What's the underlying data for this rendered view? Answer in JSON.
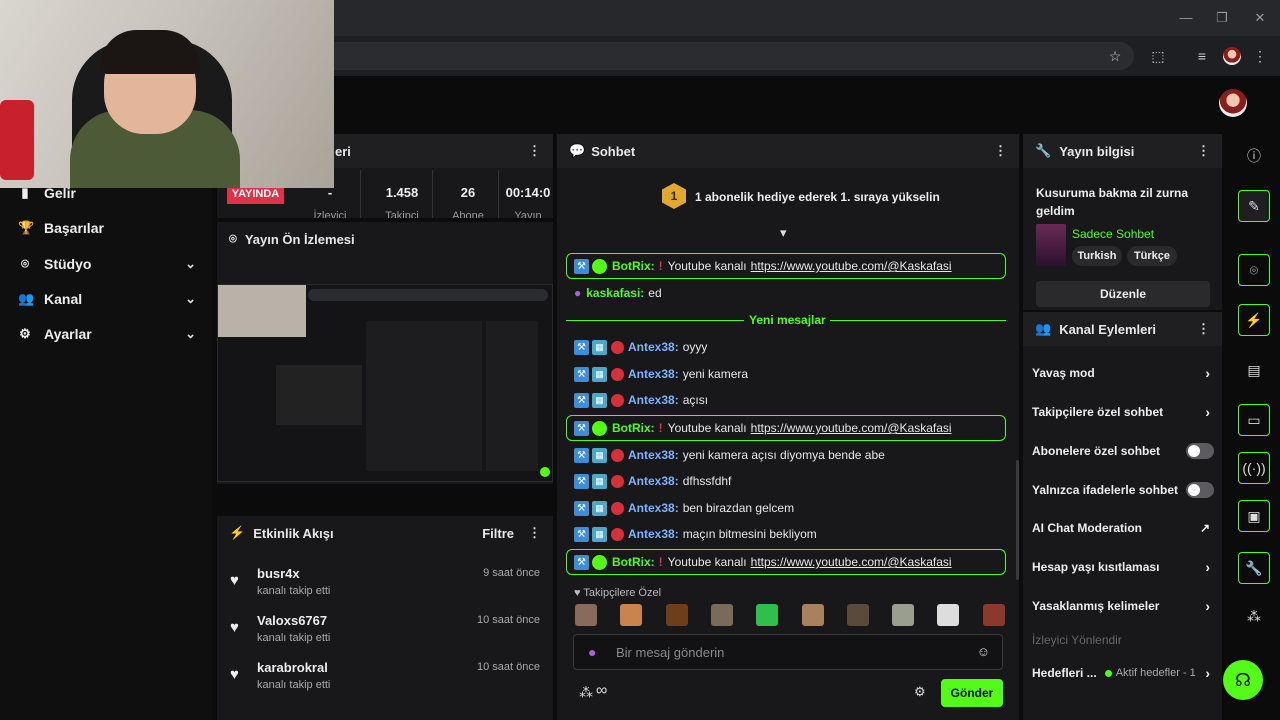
{
  "nav": {
    "items": [
      {
        "label": "Gelir",
        "icon": "chart-icon",
        "chevron": false
      },
      {
        "label": "Başarılar",
        "icon": "trophy-icon",
        "chevron": false
      },
      {
        "label": "Stüdyo",
        "icon": "studio-icon",
        "chevron": true
      },
      {
        "label": "Kanal",
        "icon": "users-icon",
        "chevron": true
      },
      {
        "label": "Ayarlar",
        "icon": "gear-icon",
        "chevron": true
      }
    ]
  },
  "stats": {
    "header_label": "eri",
    "live_badge": "YAYINDA",
    "values": [
      {
        "value": "-",
        "sub": "İzleyici"
      },
      {
        "value": "1.458",
        "sub": "Takipçi"
      },
      {
        "value": "26",
        "sub": "Abone"
      },
      {
        "value": "00:14:0",
        "sub": "Yayın"
      }
    ]
  },
  "preview": {
    "title": "Yayın Ön İzlemesi"
  },
  "feed": {
    "title": "Etkinlik Akışı",
    "filter_label": "Filtre",
    "items": [
      {
        "name": "busr4x",
        "action": "kanalı takip etti",
        "time": "9 saat önce"
      },
      {
        "name": "Valoxs6767",
        "action": "kanalı takip etti",
        "time": "10 saat önce"
      },
      {
        "name": "karabrokral",
        "action": "kanalı takip etti",
        "time": "10 saat önce"
      }
    ]
  },
  "chat": {
    "title": "Sohbet",
    "gift_banner": "1 abonelik hediye ederek 1. sıraya yükselin",
    "gift_rank": "1",
    "new_messages_divider": "Yeni mesajlar",
    "messages": [
      {
        "user": "BotRix",
        "text": "Youtube kanalı",
        "link": "https://www.youtube.com/@Kaskafasi",
        "bot": true
      },
      {
        "user": "kaskafasi",
        "text": "ed",
        "owner": true
      },
      {
        "user": "Antex38",
        "text": "oyyy"
      },
      {
        "user": "Antex38",
        "text": "yeni kamera"
      },
      {
        "user": "Antex38",
        "text": "açısı"
      },
      {
        "user": "BotRix",
        "text": "Youtube kanalı",
        "link": "https://www.youtube.com/@Kaskafasi",
        "bot": true
      },
      {
        "user": "Antex38",
        "text": "yeni kamera açısı diyomya bende abe"
      },
      {
        "user": "Antex38",
        "text": "dfhssfdhf"
      },
      {
        "user": "Antex38",
        "text": "ben birazdan gelcem"
      },
      {
        "user": "Antex38",
        "text": "maçın bitmesini bekliyom"
      },
      {
        "user": "BotRix",
        "text": "Youtube kanalı",
        "link": "https://www.youtube.com/@Kaskafasi",
        "bot": true
      }
    ],
    "followers_label": "Takipçilere Özel",
    "input_placeholder": "Bir mesaj gönderin",
    "send_label": "Gönder",
    "infinity": "∞"
  },
  "stream_info": {
    "title": "Yayın bilgisi",
    "stream_title": "Kusuruma bakma zil zurna geldim",
    "category": "Sadece Sohbet",
    "tags": [
      "Turkish",
      "Türkçe"
    ],
    "edit_label": "Düzenle"
  },
  "channel_actions": {
    "title": "Kanal Eylemleri",
    "items": [
      {
        "label": "Yavaş mod",
        "type": "arrow"
      },
      {
        "label": "Takipçilere özel sohbet",
        "type": "arrow"
      },
      {
        "label": "Abonelere özel sohbet",
        "type": "toggle"
      },
      {
        "label": "Yalnızca ifadelerle sohbet",
        "type": "toggle"
      },
      {
        "label": "AI Chat Moderation",
        "type": "external"
      },
      {
        "label": "Hesap yaşı kısıtlaması",
        "type": "arrow"
      },
      {
        "label": "Yasaklanmış kelimeler",
        "type": "arrow"
      }
    ],
    "section_label": "İzleyici Yönlendir",
    "goals_label": "Hedefleri ...",
    "goals_status": "Aktif hedefler - 1"
  },
  "colors": {
    "accent": "#53fc18",
    "live": "#e0314b",
    "panel": "#18181a"
  }
}
